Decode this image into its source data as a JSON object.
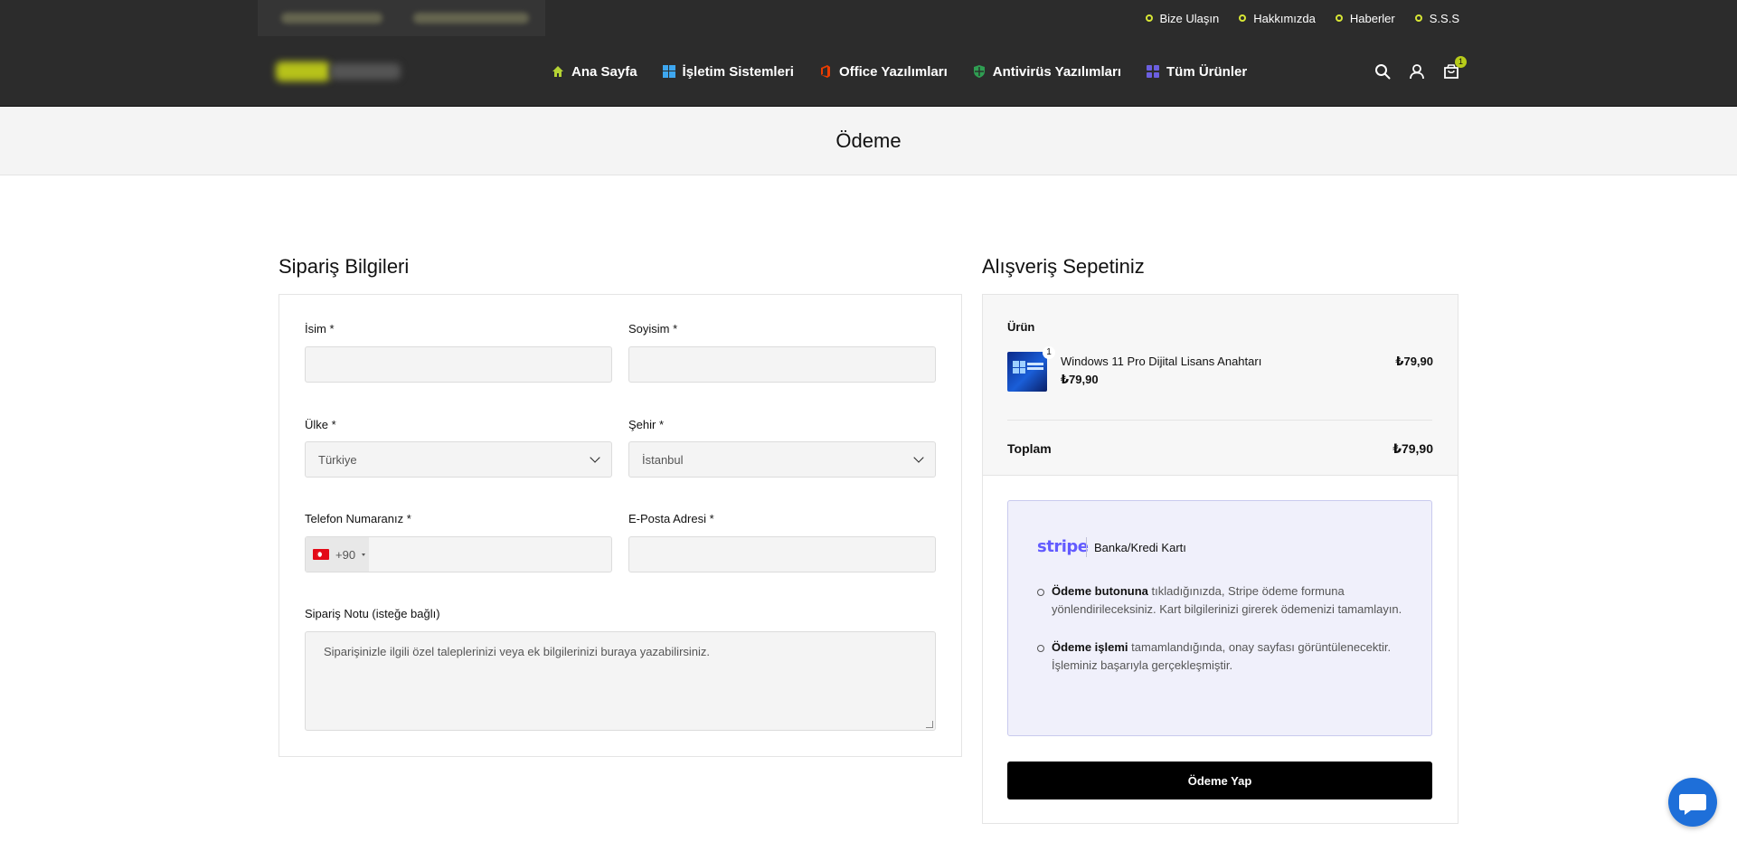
{
  "topbar": {
    "links": [
      {
        "label": "Bize Ulaşın"
      },
      {
        "label": "Hakkımızda"
      },
      {
        "label": "Haberler"
      },
      {
        "label": "S.S.S"
      }
    ]
  },
  "nav": {
    "items": [
      {
        "label": "Ana Sayfa",
        "icon": "home-icon"
      },
      {
        "label": "İşletim Sistemleri",
        "icon": "windows-icon"
      },
      {
        "label": "Office Yazılımları",
        "icon": "office-icon"
      },
      {
        "label": "Antivirüs Yazılımları",
        "icon": "antivirus-icon"
      },
      {
        "label": "Tüm Ürünler",
        "icon": "grid-icon"
      }
    ],
    "cart_count": "1"
  },
  "page": {
    "title": "Ödeme"
  },
  "order_form": {
    "heading": "Sipariş Bilgileri",
    "first_name_label": "İsim *",
    "first_name_value": "",
    "last_name_label": "Soyisim *",
    "last_name_value": "",
    "country_label": "Ülke *",
    "country_value": "Türkiye",
    "city_label": "Şehir *",
    "city_value": "İstanbul",
    "phone_label": "Telefon Numaranız *",
    "phone_prefix": "+90",
    "phone_value": "",
    "email_label": "E-Posta Adresi *",
    "email_value": "",
    "note_label": "Sipariş Notu (isteğe bağlı)",
    "note_placeholder": "Siparişinizle ilgili özel taleplerinizi veya ek bilgilerinizi buraya yazabilirsiniz."
  },
  "cart": {
    "heading": "Alışveriş Sepetiniz",
    "product_column": "Ürün",
    "items": [
      {
        "name": "Windows 11 Pro Dijital Lisans Anahtarı",
        "quantity": "1",
        "unit_price": "₺79,90",
        "total": "₺79,90"
      }
    ],
    "total_label": "Toplam",
    "total_value": "₺79,90"
  },
  "payment": {
    "provider_logo": "stripe",
    "method_label": "Banka/Kredi Kartı",
    "instructions": [
      {
        "bold": "Ödeme butonuna",
        "text": " tıkladığınızda, Stripe ödeme formuna yönlendirileceksiniz. Kart bilgilerinizi girerek ödemenizi tamamlayın."
      },
      {
        "bold": "Ödeme işlemi",
        "text": " tamamlandığında, onay sayfası görüntülenecektir. İşleminiz başarıyla gerçekleşmiştir."
      }
    ],
    "pay_button_label": "Ödeme Yap"
  },
  "colors": {
    "header_bg": "#2c2c2c",
    "accent": "#d7e635",
    "stripe": "#635bff",
    "pay_button": "#000000",
    "chat": "#1e6fd9"
  }
}
